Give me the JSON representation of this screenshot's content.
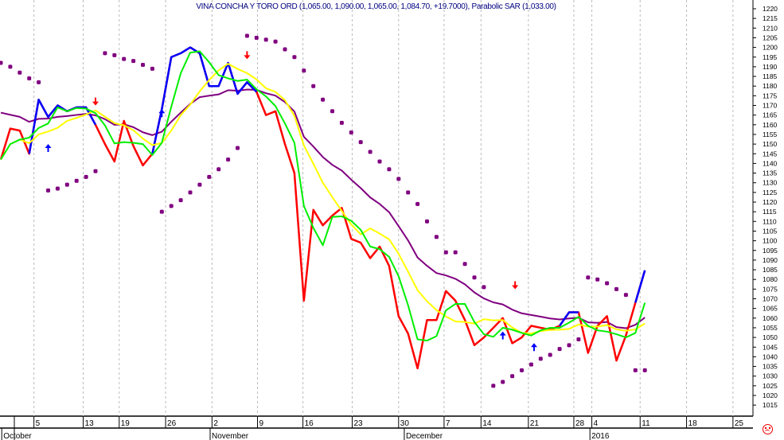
{
  "title": "VINA CONCHA Y TORO ORD (1,065.00, 1,090.00, 1,065.00, 1,084.70, +19.7000), Parabolic SAR (1,033.00)",
  "status_icon": "frown-icon",
  "chart_data": {
    "type": "line",
    "title": "VINA CONCHA Y TORO ORD (1,065.00, 1,090.00, 1,065.00, 1,084.70, +19.7000), Parabolic SAR (1,033.00)",
    "ylim": [
      1010,
      1222
    ],
    "y_ticks": [
      1015,
      1020,
      1025,
      1030,
      1035,
      1040,
      1045,
      1050,
      1055,
      1060,
      1065,
      1070,
      1075,
      1080,
      1085,
      1090,
      1095,
      1100,
      1105,
      1110,
      1115,
      1120,
      1125,
      1130,
      1135,
      1140,
      1145,
      1150,
      1155,
      1160,
      1165,
      1170,
      1175,
      1180,
      1185,
      1190,
      1195,
      1200,
      1205,
      1210,
      1215,
      1220
    ],
    "y_axis_side": "right",
    "grid": "vertical dashed at week ticks",
    "x_day_ticks": [
      {
        "label": "5",
        "index": 3.5
      },
      {
        "label": "13",
        "index": 8.7
      },
      {
        "label": "19",
        "index": 12.5
      },
      {
        "label": "26",
        "index": 17.4
      },
      {
        "label": "2",
        "index": 22.3
      },
      {
        "label": "9",
        "index": 27.1
      },
      {
        "label": "16",
        "index": 31.9
      },
      {
        "label": "23",
        "index": 37.1
      },
      {
        "label": "30",
        "index": 42
      },
      {
        "label": "7",
        "index": 46.8
      },
      {
        "label": "14",
        "index": 50.7
      },
      {
        "label": "21",
        "index": 55.7
      },
      {
        "label": "28",
        "index": 60.5
      },
      {
        "label": "4",
        "index": 62.4
      },
      {
        "label": "11",
        "index": 67.5
      },
      {
        "label": "18",
        "index": 72.4
      },
      {
        "label": "25",
        "index": 77.3
      }
    ],
    "x_months": [
      {
        "label": "October",
        "index": 0.1
      },
      {
        "label": "November",
        "index": 22.1
      },
      {
        "label": "December",
        "index": 42.6
      },
      {
        "label": "2016",
        "index": 62.2
      }
    ],
    "close": [
      1142,
      1158,
      1157,
      1145,
      1173,
      1164,
      1170,
      1167,
      1169,
      1169,
      1160,
      1150,
      1141,
      1162,
      1149,
      1139,
      1145,
      1168,
      1195,
      1197,
      1200,
      1197,
      1180,
      1180,
      1192,
      1176,
      1182,
      1177,
      1165,
      1167,
      1150,
      1135,
      1069,
      1116,
      1108,
      1113,
      1117,
      1101,
      1099,
      1091,
      1097,
      1087,
      1061,
      1052,
      1034,
      1059,
      1059,
      1074,
      1069,
      1059,
      1046,
      1050,
      1055,
      1060,
      1047,
      1050,
      1056,
      1055,
      1054,
      1056,
      1063,
      1063,
      1042,
      1056,
      1061,
      1038,
      1051,
      1068,
      1084.7
    ],
    "close_blue_ranges": [
      [
        3,
        10
      ],
      [
        16,
        27
      ],
      [
        59,
        61
      ],
      [
        67,
        68
      ]
    ],
    "moving_averages": [
      {
        "name": "short",
        "period": 3,
        "color": "#00ee00"
      },
      {
        "name": "medium",
        "period": 7,
        "color": "#ffff00"
      },
      {
        "name": "long",
        "ema_period": 14,
        "seed": 1170,
        "color": "#800080"
      }
    ],
    "parabolic_sar": [
      {
        "start": 0,
        "values": [
          1192,
          1190,
          1187,
          1184,
          1182
        ]
      },
      {
        "start": 5,
        "values": [
          1126,
          1127,
          1129,
          1131,
          1133,
          1136
        ]
      },
      {
        "start": 11,
        "values": [
          1197,
          1196,
          1194,
          1193,
          1191,
          1189
        ]
      },
      {
        "start": 17,
        "values": [
          1115,
          1118,
          1121,
          1125,
          1129,
          1133,
          1137,
          1142,
          1148
        ]
      },
      {
        "start": 26,
        "values": [
          1206,
          1205,
          1204,
          1203,
          1199,
          1195,
          1188,
          1180,
          1173,
          1167,
          1161,
          1156,
          1151,
          1146,
          1141,
          1137,
          1132,
          1125,
          1119,
          1110,
          1102,
          1094,
          1094,
          1088,
          1081,
          1076
        ]
      },
      {
        "start": 52,
        "values": [
          1025,
          1027,
          1030,
          1033,
          1036,
          1039,
          1041,
          1044,
          1046,
          1049
        ]
      },
      {
        "start": 62,
        "values": [
          1081,
          1080,
          1078,
          1075,
          1072
        ]
      },
      {
        "start": 67,
        "values": [
          1033,
          1033
        ]
      }
    ],
    "signals": [
      {
        "type": "buy",
        "index": 5,
        "value": 1148
      },
      {
        "type": "sell",
        "index": 10,
        "value": 1172
      },
      {
        "type": "buy",
        "index": 17,
        "value": 1166
      },
      {
        "type": "sell",
        "index": 26,
        "value": 1196
      },
      {
        "type": "buy",
        "index": 53,
        "value": 1051
      },
      {
        "type": "sell",
        "index": 54.3,
        "value": 1077
      },
      {
        "type": "buy",
        "index": 56.3,
        "value": 1045
      }
    ],
    "colors": {
      "close_down": "#ff0000",
      "close_up": "#0000ff",
      "sar": "#800080",
      "buy": "#0000ff",
      "sell": "#ff0000"
    }
  }
}
